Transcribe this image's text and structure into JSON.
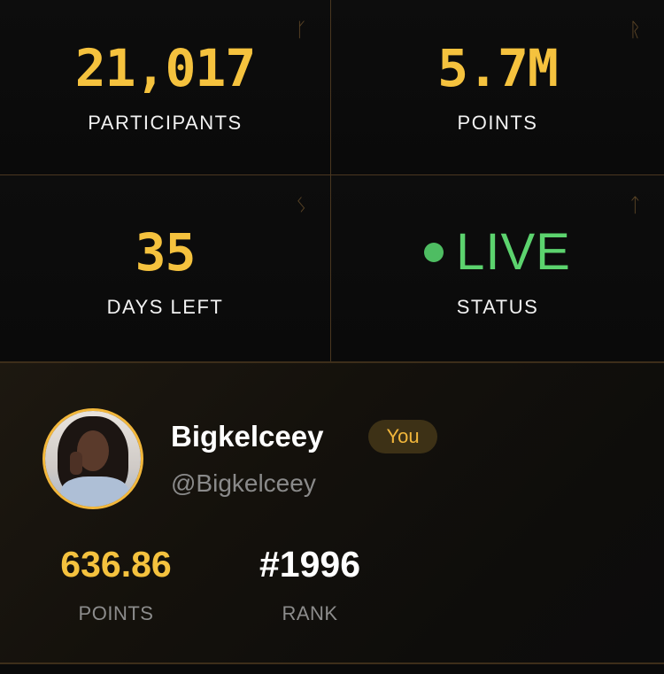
{
  "stats": {
    "participants": {
      "value": "21,017",
      "label": "PARTICIPANTS",
      "rune": "ᚴ"
    },
    "points": {
      "value": "5.7M",
      "label": "POINTS",
      "rune": "ᚱ"
    },
    "days_left": {
      "value": "35",
      "label": "DAYS LEFT",
      "rune": "ᛊ"
    },
    "status": {
      "value": "LIVE",
      "label": "STATUS",
      "rune": "ᛏ"
    }
  },
  "profile": {
    "username": "Bigkelceey",
    "badge": "You",
    "handle": "@Bigkelceey",
    "points": {
      "value": "636.86",
      "label": "POINTS"
    },
    "rank": {
      "value": "#1996",
      "label": "RANK"
    }
  },
  "colors": {
    "accent_gold": "#f5c23e",
    "live_green": "#5cd36e",
    "divider_bronze": "#4a3720"
  }
}
